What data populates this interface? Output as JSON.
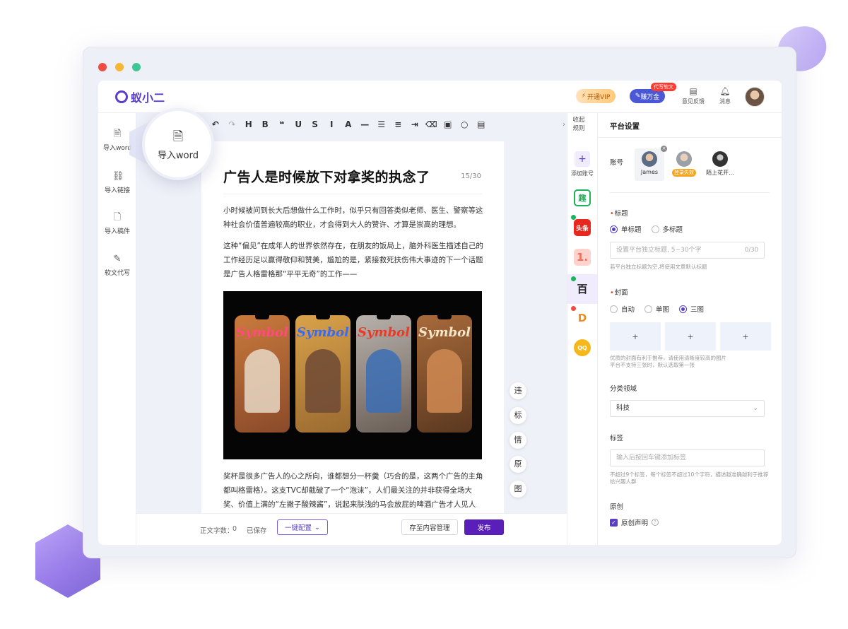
{
  "app": {
    "name": "蚁小二"
  },
  "header": {
    "vip_label": "开通VIP",
    "ai_label": "赚万金",
    "ai_badge": "代写软文",
    "feedback_label": "意见反馈",
    "message_label": "消息"
  },
  "left_sidebar": {
    "items": [
      {
        "label": "导入word",
        "icon": "word-file-icon"
      },
      {
        "label": "导入链接",
        "icon": "link-icon"
      },
      {
        "label": "导入稿件",
        "icon": "document-icon"
      },
      {
        "label": "软文代写",
        "icon": "edit-icon"
      }
    ],
    "magnified_label": "导入word"
  },
  "toolbar": {
    "buttons": [
      "undo-icon",
      "redo-icon",
      "heading-icon",
      "bold-icon",
      "quote-icon",
      "underline-icon",
      "strikethrough-icon",
      "italic-icon",
      "font-color-icon",
      "horizontal-rule-icon",
      "list-icon",
      "align-icon",
      "indent-icon",
      "eraser-icon",
      "image-icon",
      "search-icon",
      "template-icon"
    ],
    "glyphs": [
      "↶",
      "↷",
      "H",
      "B",
      "❝",
      "U",
      "S",
      "I",
      "A",
      "—",
      "☰",
      "≡",
      "⇥",
      "⌫",
      "▣",
      "○",
      "▤"
    ]
  },
  "article": {
    "title": "广告人是时候放下对拿奖的执念了",
    "title_count": "15/30",
    "para1": "小时候被问到长大后想做什么工作时，似乎只有回答类似老师、医生、警察等这种社会价值普遍较高的职业，才会得到大人的赞许、才算是崇高的理想。",
    "para2": "这种“偏见”在成年人的世界依然存在，在朋友的饭局上，脑外科医生描述自己的工作经历足以赢得敬仰和赞美，尴尬的是，紧接救死扶伤伟大事迹的下一个话题是广告人格雷格那“平平无奇”的工作——",
    "para3": "奖杯是很多广告人的心之所向，谁都想分一杯羹（巧合的是，这两个广告的主角都叫格雷格）。这支TVC却截破了一个“泡沫”，人们最关注的并非获得全场大奖、价值上满的“左撇子酸辣酱”，说起来肤浅的马会放屁的啤酒广告才人见人爱。",
    "image_brand": "Symbol"
  },
  "float_tools": [
    "违",
    "标",
    "情",
    "原",
    "图"
  ],
  "bottom_bar": {
    "word_count_label": "正文字数：",
    "word_count": "0",
    "saved_label": "已保存",
    "config_button": "一键配置",
    "save_button": "存至内容管理",
    "publish_button": "发布"
  },
  "platform_column": {
    "collapse_label_1": "收起",
    "collapse_label_2": "规则",
    "add_account_label": "添加账号",
    "platforms": [
      {
        "name": "趣",
        "color": "#1cb45b"
      },
      {
        "name": "头条",
        "color": "#e8281e"
      },
      {
        "name": "1.",
        "color": "#f56c5c"
      },
      {
        "name": "百",
        "color": "#222222"
      },
      {
        "name": "D",
        "color": "#f08c1f"
      },
      {
        "name": "QQ",
        "color": "#f6b719"
      }
    ]
  },
  "right_panel": {
    "title": "平台设置",
    "account_label": "账号",
    "accounts": [
      {
        "name": "James"
      },
      {
        "name": "登录失效"
      },
      {
        "name": "陌上花开..."
      }
    ],
    "title_section": {
      "label": "标题",
      "options": [
        "单标题",
        "多标题"
      ],
      "selected": "单标题",
      "placeholder": "设置平台独立标题, 5~30个字",
      "counter": "0/30",
      "hint": "若平台独立标题为空,将使用文章默认标题"
    },
    "cover_section": {
      "label": "封面",
      "options": [
        "自动",
        "单图",
        "三图"
      ],
      "selected": "三图",
      "slots": [
        "+",
        "+",
        "+"
      ],
      "hint_1": "优质的封面有利于推荐，请使用清晰度较高的图片",
      "hint_2": "平台不支持三张时，默认选取第一张"
    },
    "category_section": {
      "label": "分类领域",
      "value": "科技"
    },
    "tags_section": {
      "label": "标签",
      "placeholder": "输入后按回车键添加标签",
      "hint": "不超过9个标签，每个标签不超过10个字符，描述越准确越利于推荐给兴趣人群"
    },
    "original_section": {
      "label": "原创",
      "checkbox_label": "原创声明",
      "checked": true
    }
  },
  "colors": {
    "accent": "#5a3ec8",
    "publish": "#5a1fb8",
    "editor_bg": "#eff1f8"
  }
}
